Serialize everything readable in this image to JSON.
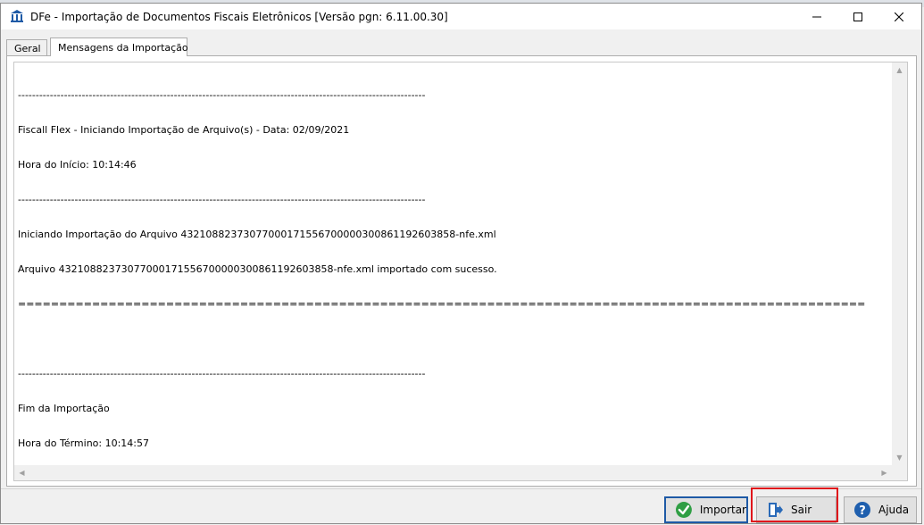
{
  "window": {
    "title": "DFe - Importação de Documentos Fiscais Eletrônicos [Versão pgn: 6.11.00.30]"
  },
  "tabs": [
    {
      "label": "Geral",
      "active": false
    },
    {
      "label": "Mensagens da Importação",
      "active": true
    }
  ],
  "log": {
    "lines": [
      "-------------------------------------------------------------------------------------------------------------------",
      "Fiscall Flex - Iniciando Importação de Arquivo(s) - Data: 02/09/2021",
      "Hora do Início: 10:14:46",
      "-------------------------------------------------------------------------------------------------------------------",
      "Iniciando Importação do Arquivo 43210882373077000171556700000300861192603858-nfe.xml",
      "Arquivo 43210882373077000171556700000300861192603858-nfe.xml importado com sucesso.",
      "=======================================================================================================",
      "",
      "-------------------------------------------------------------------------------------------------------------------",
      "Fim da Importação",
      "Hora do Término: 10:14:57"
    ]
  },
  "buttons": {
    "importar": "Importar",
    "sair": "Sair",
    "ajuda": "Ajuda"
  },
  "colors": {
    "highlight": "#e0151b",
    "importar_border": "#1e5aa6",
    "check_green": "#2f9e44",
    "help_blue": "#1f5fae"
  },
  "icons": {
    "app": "bank-icon",
    "importar": "check-circle-icon",
    "sair": "exit-door-icon",
    "ajuda": "help-circle-icon"
  }
}
